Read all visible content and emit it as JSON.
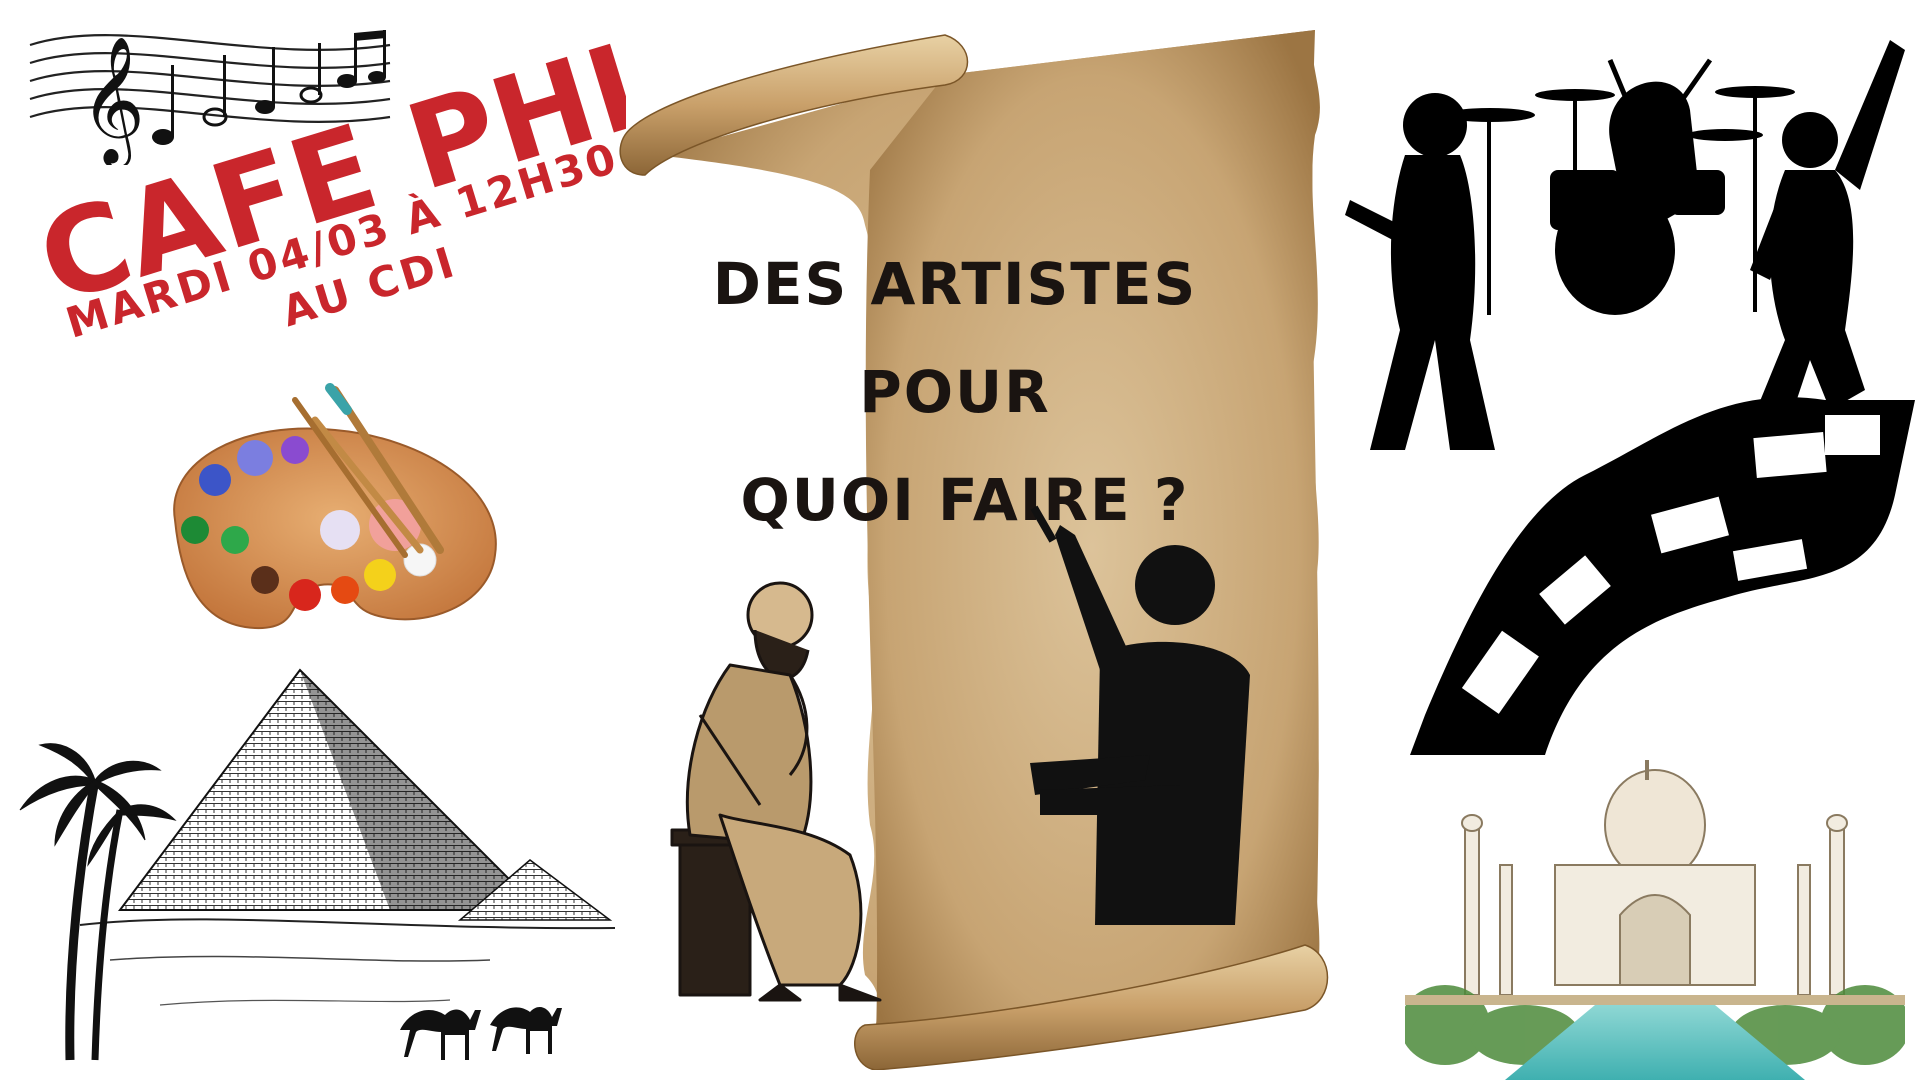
{
  "poster": {
    "title": "CAFE PHILO",
    "date_line": "MARDI 04/03 À 12H30",
    "place_line": "AU CDI",
    "question_line1": "DES ARTISTES",
    "question_line2": "POUR",
    "question_line3": "QUOI FAIRE ?"
  },
  "colors": {
    "accent_red": "#c9262c",
    "parchment": "#c9a877",
    "ink": "#1a1411"
  },
  "icons": [
    "music-staff-icon",
    "painter-palette-icon",
    "pyramid-desert-icon",
    "rock-band-silhouette-icon",
    "film-strip-icon",
    "taj-mahal-icon",
    "socrates-thinker-icon",
    "painter-boy-icon"
  ]
}
